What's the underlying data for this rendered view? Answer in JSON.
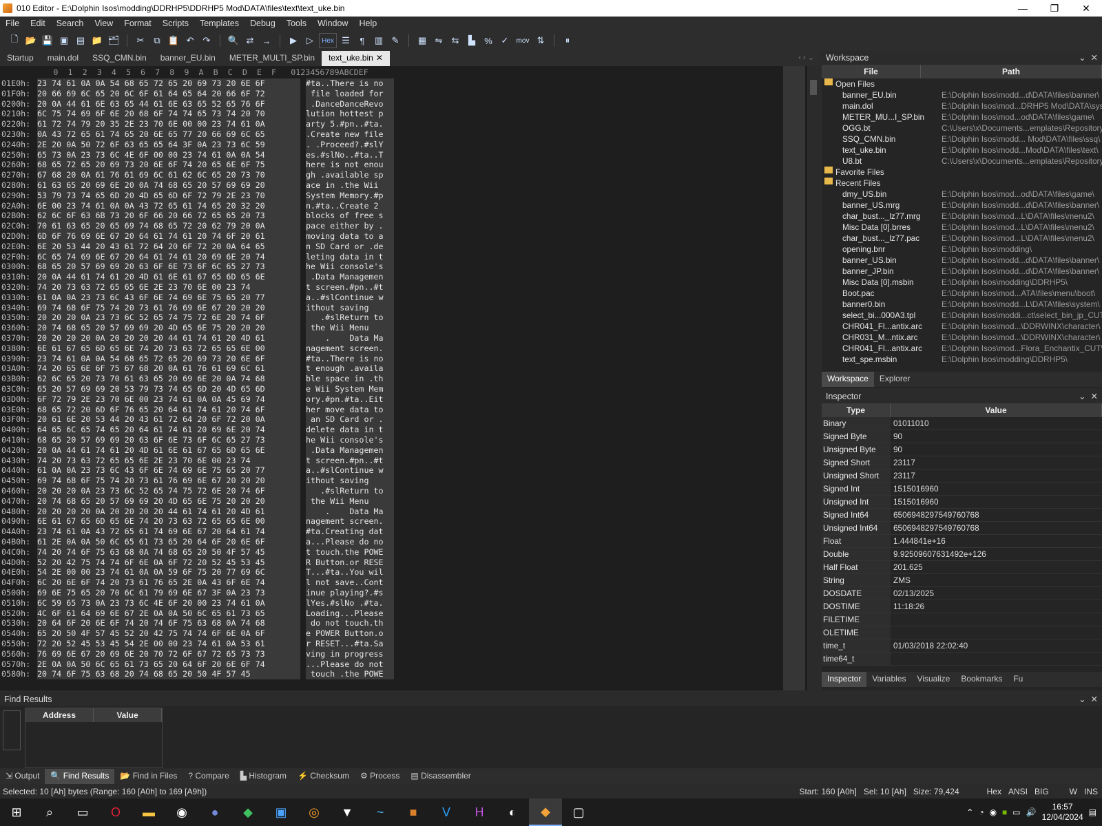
{
  "window": {
    "title": "010 Editor - E:\\Dolphin Isos\\modding\\DDRHP5\\DDRHP5 Mod\\DATA\\files\\text\\text_uke.bin",
    "minimize": "—",
    "maximize": "❐",
    "close": "✕"
  },
  "menu": [
    "File",
    "Edit",
    "Search",
    "View",
    "Format",
    "Scripts",
    "Templates",
    "Debug",
    "Tools",
    "Window",
    "Help"
  ],
  "toolbar": {
    "hex_label": "Hex",
    "mov_label": "mov"
  },
  "tabs": [
    {
      "label": "Startup"
    },
    {
      "label": "main.dol"
    },
    {
      "label": "SSQ_CMN.bin"
    },
    {
      "label": "banner_EU.bin"
    },
    {
      "label": "METER_MULTI_SP.bin"
    },
    {
      "label": "text_uke.bin",
      "active": true
    }
  ],
  "hex_header": "           0  1  2  3  4  5  6  7  8  9  A  B  C  D  E  F   0123456789ABCDEF",
  "hex_rows": [
    [
      "01E0h:",
      "23 74 61 0A 0A 54 68 65 72 65 20 69 73 20 6E 6F",
      "#ta..There is no"
    ],
    [
      "01F0h:",
      "20 66 69 6C 65 20 6C 6F 61 64 65 64 20 66 6F 72",
      " file loaded for"
    ],
    [
      "0200h:",
      "20 0A 44 61 6E 63 65 44 61 6E 63 65 52 65 76 6F",
      " .DanceDanceRevo"
    ],
    [
      "0210h:",
      "6C 75 74 69 6F 6E 20 68 6F 74 74 65 73 74 20 70",
      "lution hottest p"
    ],
    [
      "0220h:",
      "61 72 74 79 20 35 2E 23 70 6E 00 00 23 74 61 0A",
      "arty 5.#pn..#ta."
    ],
    [
      "0230h:",
      "0A 43 72 65 61 74 65 20 6E 65 77 20 66 69 6C 65",
      ".Create new file"
    ],
    [
      "0240h:",
      "2E 20 0A 50 72 6F 63 65 65 64 3F 0A 23 73 6C 59",
      ". .Proceed?.#slY"
    ],
    [
      "0250h:",
      "65 73 0A 23 73 6C 4E 6F 00 00 23 74 61 0A 0A 54",
      "es.#slNo..#ta..T"
    ],
    [
      "0260h:",
      "68 65 72 65 20 69 73 20 6E 6F 74 20 65 6E 6F 75",
      "here is not enou"
    ],
    [
      "0270h:",
      "67 68 20 0A 61 76 61 69 6C 61 62 6C 65 20 73 70",
      "gh .available sp"
    ],
    [
      "0280h:",
      "61 63 65 20 69 6E 20 0A 74 68 65 20 57 69 69 20",
      "ace in .the Wii "
    ],
    [
      "0290h:",
      "53 79 73 74 65 6D 20 4D 65 6D 6F 72 79 2E 23 70",
      "System Memory.#p"
    ],
    [
      "02A0h:",
      "6E 00 23 74 61 0A 0A 43 72 65 61 74 65 20 32 20",
      "n.#ta..Create 2 "
    ],
    [
      "02B0h:",
      "62 6C 6F 63 6B 73 20 6F 66 20 66 72 65 65 20 73",
      "blocks of free s"
    ],
    [
      "02C0h:",
      "70 61 63 65 20 65 69 74 68 65 72 20 62 79 20 0A",
      "pace either by ."
    ],
    [
      "02D0h:",
      "6D 6F 76 69 6E 67 20 64 61 74 61 20 74 6F 20 61",
      "moving data to a"
    ],
    [
      "02E0h:",
      "6E 20 53 44 20 43 61 72 64 20 6F 72 20 0A 64 65",
      "n SD Card or .de"
    ],
    [
      "02F0h:",
      "6C 65 74 69 6E 67 20 64 61 74 61 20 69 6E 20 74",
      "leting data in t"
    ],
    [
      "0300h:",
      "68 65 20 57 69 69 20 63 6F 6E 73 6F 6C 65 27 73",
      "he Wii console's"
    ],
    [
      "0310h:",
      "20 0A 44 61 74 61 20 4D 61 6E 61 67 65 6D 65 6E",
      " .Data Managemen"
    ],
    [
      "0320h:",
      "74 20 73 63 72 65 65 6E 2E 23 70 6E 00 23 74",
      "t screen.#pn..#t"
    ],
    [
      "0330h:",
      "61 0A 0A 23 73 6C 43 6F 6E 74 69 6E 75 65 20 77",
      "a..#slContinue w"
    ],
    [
      "0340h:",
      "69 74 68 6F 75 74 20 73 61 76 69 6E 67 20 20 20",
      "ithout saving   "
    ],
    [
      "0350h:",
      "20 20 20 0A 23 73 6C 52 65 74 75 72 6E 20 74 6F",
      "   .#slReturn to"
    ],
    [
      "0360h:",
      "20 74 68 65 20 57 69 69 20 4D 65 6E 75 20 20 20",
      " the Wii Menu   "
    ],
    [
      "0370h:",
      "20 20 20 20 0A 20 20 20 20 44 61 74 61 20 4D 61",
      "    .    Data Ma"
    ],
    [
      "0380h:",
      "6E 61 67 65 6D 65 6E 74 20 73 63 72 65 65 6E 00",
      "nagement screen."
    ],
    [
      "0390h:",
      "23 74 61 0A 0A 54 68 65 72 65 20 69 73 20 6E 6F",
      "#ta..There is no"
    ],
    [
      "03A0h:",
      "74 20 65 6E 6F 75 67 68 20 0A 61 76 61 69 6C 61",
      "t enough .availa"
    ],
    [
      "03B0h:",
      "62 6C 65 20 73 70 61 63 65 20 69 6E 20 0A 74 68",
      "ble space in .th"
    ],
    [
      "03C0h:",
      "65 20 57 69 69 20 53 79 73 74 65 6D 20 4D 65 6D",
      "e Wii System Mem"
    ],
    [
      "03D0h:",
      "6F 72 79 2E 23 70 6E 00 23 74 61 0A 0A 45 69 74",
      "ory.#pn.#ta..Eit"
    ],
    [
      "03E0h:",
      "68 65 72 20 6D 6F 76 65 20 64 61 74 61 20 74 6F",
      "her move data to"
    ],
    [
      "03F0h:",
      "20 61 6E 20 53 44 20 43 61 72 64 20 6F 72 20 0A",
      " an SD Card or ."
    ],
    [
      "0400h:",
      "64 65 6C 65 74 65 20 64 61 74 61 20 69 6E 20 74",
      "delete data in t"
    ],
    [
      "0410h:",
      "68 65 20 57 69 69 20 63 6F 6E 73 6F 6C 65 27 73",
      "he Wii console's"
    ],
    [
      "0420h:",
      "20 0A 44 61 74 61 20 4D 61 6E 61 67 65 6D 65 6E",
      " .Data Managemen"
    ],
    [
      "0430h:",
      "74 20 73 63 72 65 65 6E 2E 23 70 6E 00 23 74",
      "t screen.#pn..#t"
    ],
    [
      "0440h:",
      "61 0A 0A 23 73 6C 43 6F 6E 74 69 6E 75 65 20 77",
      "a..#slContinue w"
    ],
    [
      "0450h:",
      "69 74 68 6F 75 74 20 73 61 76 69 6E 67 20 20 20",
      "ithout saving   "
    ],
    [
      "0460h:",
      "20 20 20 0A 23 73 6C 52 65 74 75 72 6E 20 74 6F",
      "   .#slReturn to"
    ],
    [
      "0470h:",
      "20 74 68 65 20 57 69 69 20 4D 65 6E 75 20 20 20",
      " the Wii Menu   "
    ],
    [
      "0480h:",
      "20 20 20 20 0A 20 20 20 20 44 61 74 61 20 4D 61",
      "    .    Data Ma"
    ],
    [
      "0490h:",
      "6E 61 67 65 6D 65 6E 74 20 73 63 72 65 65 6E 00",
      "nagement screen."
    ],
    [
      "04A0h:",
      "23 74 61 0A 43 72 65 61 74 69 6E 67 20 64 61 74",
      "#ta.Creating dat"
    ],
    [
      "04B0h:",
      "61 2E 0A 0A 50 6C 65 61 73 65 20 64 6F 20 6E 6F",
      "a...Please do no"
    ],
    [
      "04C0h:",
      "74 20 74 6F 75 63 68 0A 74 68 65 20 50 4F 57 45",
      "t touch.the POWE"
    ],
    [
      "04D0h:",
      "52 20 42 75 74 74 6F 6E 0A 6F 72 20 52 45 53 45",
      "R Button.or RESE"
    ],
    [
      "04E0h:",
      "54 2E 00 00 23 74 61 0A 0A 59 6F 75 20 77 69 6C",
      "T...#ta..You wil"
    ],
    [
      "04F0h:",
      "6C 20 6E 6F 74 20 73 61 76 65 2E 0A 43 6F 6E 74",
      "l not save..Cont"
    ],
    [
      "0500h:",
      "69 6E 75 65 20 70 6C 61 79 69 6E 67 3F 0A 23 73",
      "inue playing?.#s"
    ],
    [
      "0510h:",
      "6C 59 65 73 0A 23 73 6C 4E 6F 20 00 23 74 61 0A",
      "lYes.#slNo .#ta."
    ],
    [
      "0520h:",
      "4C 6F 61 64 69 6E 67 2E 0A 0A 50 6C 65 61 73 65",
      "Loading...Please"
    ],
    [
      "0530h:",
      "20 64 6F 20 6E 6F 74 20 74 6F 75 63 68 0A 74 68",
      " do not touch.th"
    ],
    [
      "0540h:",
      "65 20 50 4F 57 45 52 20 42 75 74 74 6F 6E 0A 6F",
      "e POWER Button.o"
    ],
    [
      "0550h:",
      "72 20 52 45 53 45 54 2E 00 00 23 74 61 0A 53 61",
      "r RESET...#ta.Sa"
    ],
    [
      "0560h:",
      "76 69 6E 67 20 69 6E 20 70 72 6F 67 72 65 73 73",
      "ving in progress"
    ],
    [
      "0570h:",
      "2E 0A 0A 50 6C 65 61 73 65 20 64 6F 20 6E 6F 74",
      "...Please do not"
    ],
    [
      "0580h:",
      "20 74 6F 75 63 68 20 74 68 65 20 50 4F 57 45",
      " touch .the POWE"
    ]
  ],
  "workspace": {
    "title": "Workspace",
    "col_file": "File",
    "col_path": "Path",
    "groups": [
      {
        "name": "Open Files",
        "items": [
          [
            "banner_EU.bin",
            "E:\\Dolphin Isos\\modd...d\\DATA\\files\\banner\\"
          ],
          [
            "main.dol",
            "E:\\Dolphin Isos\\mod...DRHP5 Mod\\DATA\\sys\\"
          ],
          [
            "METER_MU...I_SP.bin",
            "E:\\Dolphin Isos\\mod...od\\DATA\\files\\game\\"
          ],
          [
            "OGG.bt",
            "C:\\Users\\x\\Documents...emplates\\Repository\\"
          ],
          [
            "SSQ_CMN.bin",
            "E:\\Dolphin Isos\\modd... Mod\\DATA\\files\\ssq\\"
          ],
          [
            "text_uke.bin",
            "E:\\Dolphin Isos\\modd...Mod\\DATA\\files\\text\\"
          ],
          [
            "U8.bt",
            "C:\\Users\\x\\Documents...emplates\\Repository\\"
          ]
        ]
      },
      {
        "name": "Favorite Files",
        "items": []
      },
      {
        "name": "Recent Files",
        "items": [
          [
            "dmy_US.bin",
            "E:\\Dolphin Isos\\mod...od\\DATA\\files\\game\\"
          ],
          [
            "banner_US.mrg",
            "E:\\Dolphin Isos\\modd...d\\DATA\\files\\banner\\"
          ],
          [
            "char_bust..._lz77.mrg",
            "E:\\Dolphin Isos\\mod...L\\DATA\\files\\menu2\\"
          ],
          [
            "Misc Data [0].brres",
            "E:\\Dolphin Isos\\mod...L\\DATA\\files\\menu2\\"
          ],
          [
            "char_bust..._lz77.pac",
            "E:\\Dolphin Isos\\mod...L\\DATA\\files\\menu2\\"
          ],
          [
            "opening.bnr",
            "E:\\Dolphin Isos\\modding\\"
          ],
          [
            "banner_US.bin",
            "E:\\Dolphin Isos\\modd...d\\DATA\\files\\banner\\"
          ],
          [
            "banner_JP.bin",
            "E:\\Dolphin Isos\\modd...d\\DATA\\files\\banner\\"
          ],
          [
            "Misc Data [0].msbin",
            "E:\\Dolphin Isos\\modding\\DDRHP5\\"
          ],
          [
            "Boot.pac",
            "E:\\Dolphin Isos\\mod...ATA\\files\\menu\\boot\\"
          ],
          [
            "banner0.bin",
            "E:\\Dolphin Isos\\modd...L\\DATA\\files\\system\\"
          ],
          [
            "select_bi...000A3.tpl",
            "E:\\Dolphin Isos\\moddi...ct\\select_bin_jp_CUT\\"
          ],
          [
            "CHR041_Fl...antix.arc",
            "E:\\Dolphin Isos\\mod...\\DDRWINX\\character\\"
          ],
          [
            "CHR031_M...ntix.arc",
            "E:\\Dolphin Isos\\mod...\\DDRWINX\\character\\"
          ],
          [
            "CHR041_Fl...antix.arc",
            "E:\\Dolphin Isos\\mod...Flora_Enchantix_CUT\\"
          ],
          [
            "text_spe.msbin",
            "E:\\Dolphin Isos\\modding\\DDRHP5\\"
          ]
        ]
      }
    ],
    "tabs": [
      "Workspace",
      "Explorer"
    ]
  },
  "inspector": {
    "title": "Inspector",
    "col_type": "Type",
    "col_value": "Value",
    "rows": [
      [
        "Binary",
        "01011010"
      ],
      [
        "Signed Byte",
        "90"
      ],
      [
        "Unsigned Byte",
        "90"
      ],
      [
        "Signed Short",
        "23117"
      ],
      [
        "Unsigned Short",
        "23117"
      ],
      [
        "Signed Int",
        "1515016960"
      ],
      [
        "Unsigned Int",
        "1515016960"
      ],
      [
        "Signed Int64",
        "6506948297549760768"
      ],
      [
        "Unsigned Int64",
        "6506948297549760768"
      ],
      [
        "Float",
        "1.444841e+16"
      ],
      [
        "Double",
        "9.92509607631492e+126"
      ],
      [
        "Half Float",
        "201.625"
      ],
      [
        "String",
        "ZMS"
      ],
      [
        "DOSDATE",
        "02/13/2025"
      ],
      [
        "DOSTIME",
        "11:18:26"
      ],
      [
        "FILETIME",
        ""
      ],
      [
        "OLETIME",
        ""
      ],
      [
        "time_t",
        "01/03/2018 22:02:40"
      ],
      [
        "time64_t",
        ""
      ]
    ],
    "tabs": [
      "Inspector",
      "Variables",
      "Visualize",
      "Bookmarks",
      "Fu"
    ]
  },
  "find_results": {
    "title": "Find Results",
    "col_address": "Address",
    "col_value": "Value"
  },
  "bottom_tabs": [
    "Output",
    "Find Results",
    "Find in Files",
    "Compare",
    "Histogram",
    "Checksum",
    "Process",
    "Disassembler"
  ],
  "status": {
    "left": "Selected: 10 [Ah] bytes (Range: 160 [A0h] to 169 [A9h])",
    "start": "Start: 160 [A0h]",
    "sel": "Sel: 10 [Ah]",
    "size": "Size: 79,424",
    "mode": "Hex",
    "enc": "ANSI",
    "endian": "BIG",
    "w": "W",
    "ins": "INS"
  },
  "taskbar": {
    "time": "16:57",
    "date": "12/04/2024"
  }
}
